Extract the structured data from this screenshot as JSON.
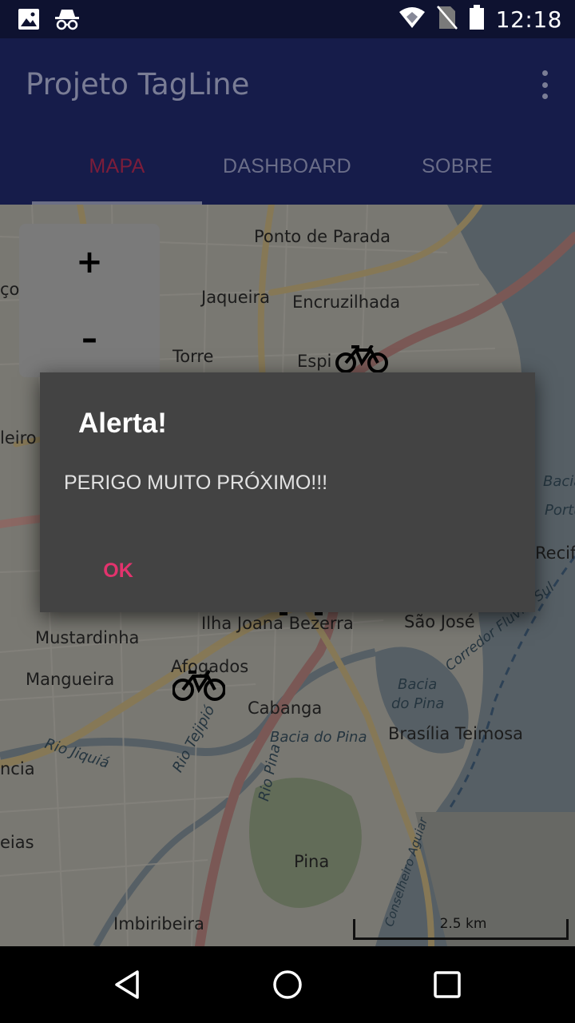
{
  "status_bar": {
    "time": "12:18",
    "icons": [
      "image-icon",
      "incognito-icon",
      "wifi-icon",
      "no-sim-icon",
      "battery-icon"
    ]
  },
  "app_bar": {
    "title": "Projeto TagLine",
    "overflow_icon": "more-vert-icon"
  },
  "tabs": [
    {
      "label": "MAPA",
      "active": true
    },
    {
      "label": "DASHBOARD",
      "active": false
    },
    {
      "label": "SOBRE",
      "active": false
    }
  ],
  "map": {
    "zoom_in": "+",
    "zoom_out": "–",
    "scale": "2.5 km",
    "labels": {
      "ponto_de_parada": "Ponto de Parada",
      "jaqueira": "Jaqueira",
      "encruzilhada": "Encruzilhada",
      "torre": "Torre",
      "espinheiro": "Espi",
      "ilha_joana_bezerra": "Ilha Joana Bezerra",
      "sao_jose": "São José",
      "mustardinha": "Mustardinha",
      "mangueira": "Mangueira",
      "afogados": "Afogados",
      "cabanga": "Cabanga",
      "brasilia_teimosa": "Brasília Teimosa",
      "pina": "Pina",
      "imbiribeira": "Imbiribeira",
      "bacia_do_pina_1": "Bacia",
      "bacia_do_pina_2": "do Pina",
      "bacia_do_pina_road": "Bacia do Pina",
      "corredor": "Corredor Fluvial Sul",
      "recife": "Recif",
      "rio_jiquia": "Rio Jiquiá",
      "rio_tejipio": "Rio Tejipió",
      "rio_pina": "Rio Pina",
      "conselheiro_aguiar": "Conselheiro Aguiar",
      "bacia_portuaria_1": "Bacia",
      "bacia_portuaria_2": "Portu",
      "left_1": "ço",
      "left_2": "leiro",
      "left_3": "ncia",
      "left_4": "eias"
    }
  },
  "dialog": {
    "title": "Alerta!",
    "message": "PERIGO MUITO PRÓXIMO!!!",
    "ok": "OK"
  },
  "nav_bar": {
    "icons": [
      "back-icon",
      "home-icon",
      "recents-icon"
    ]
  }
}
